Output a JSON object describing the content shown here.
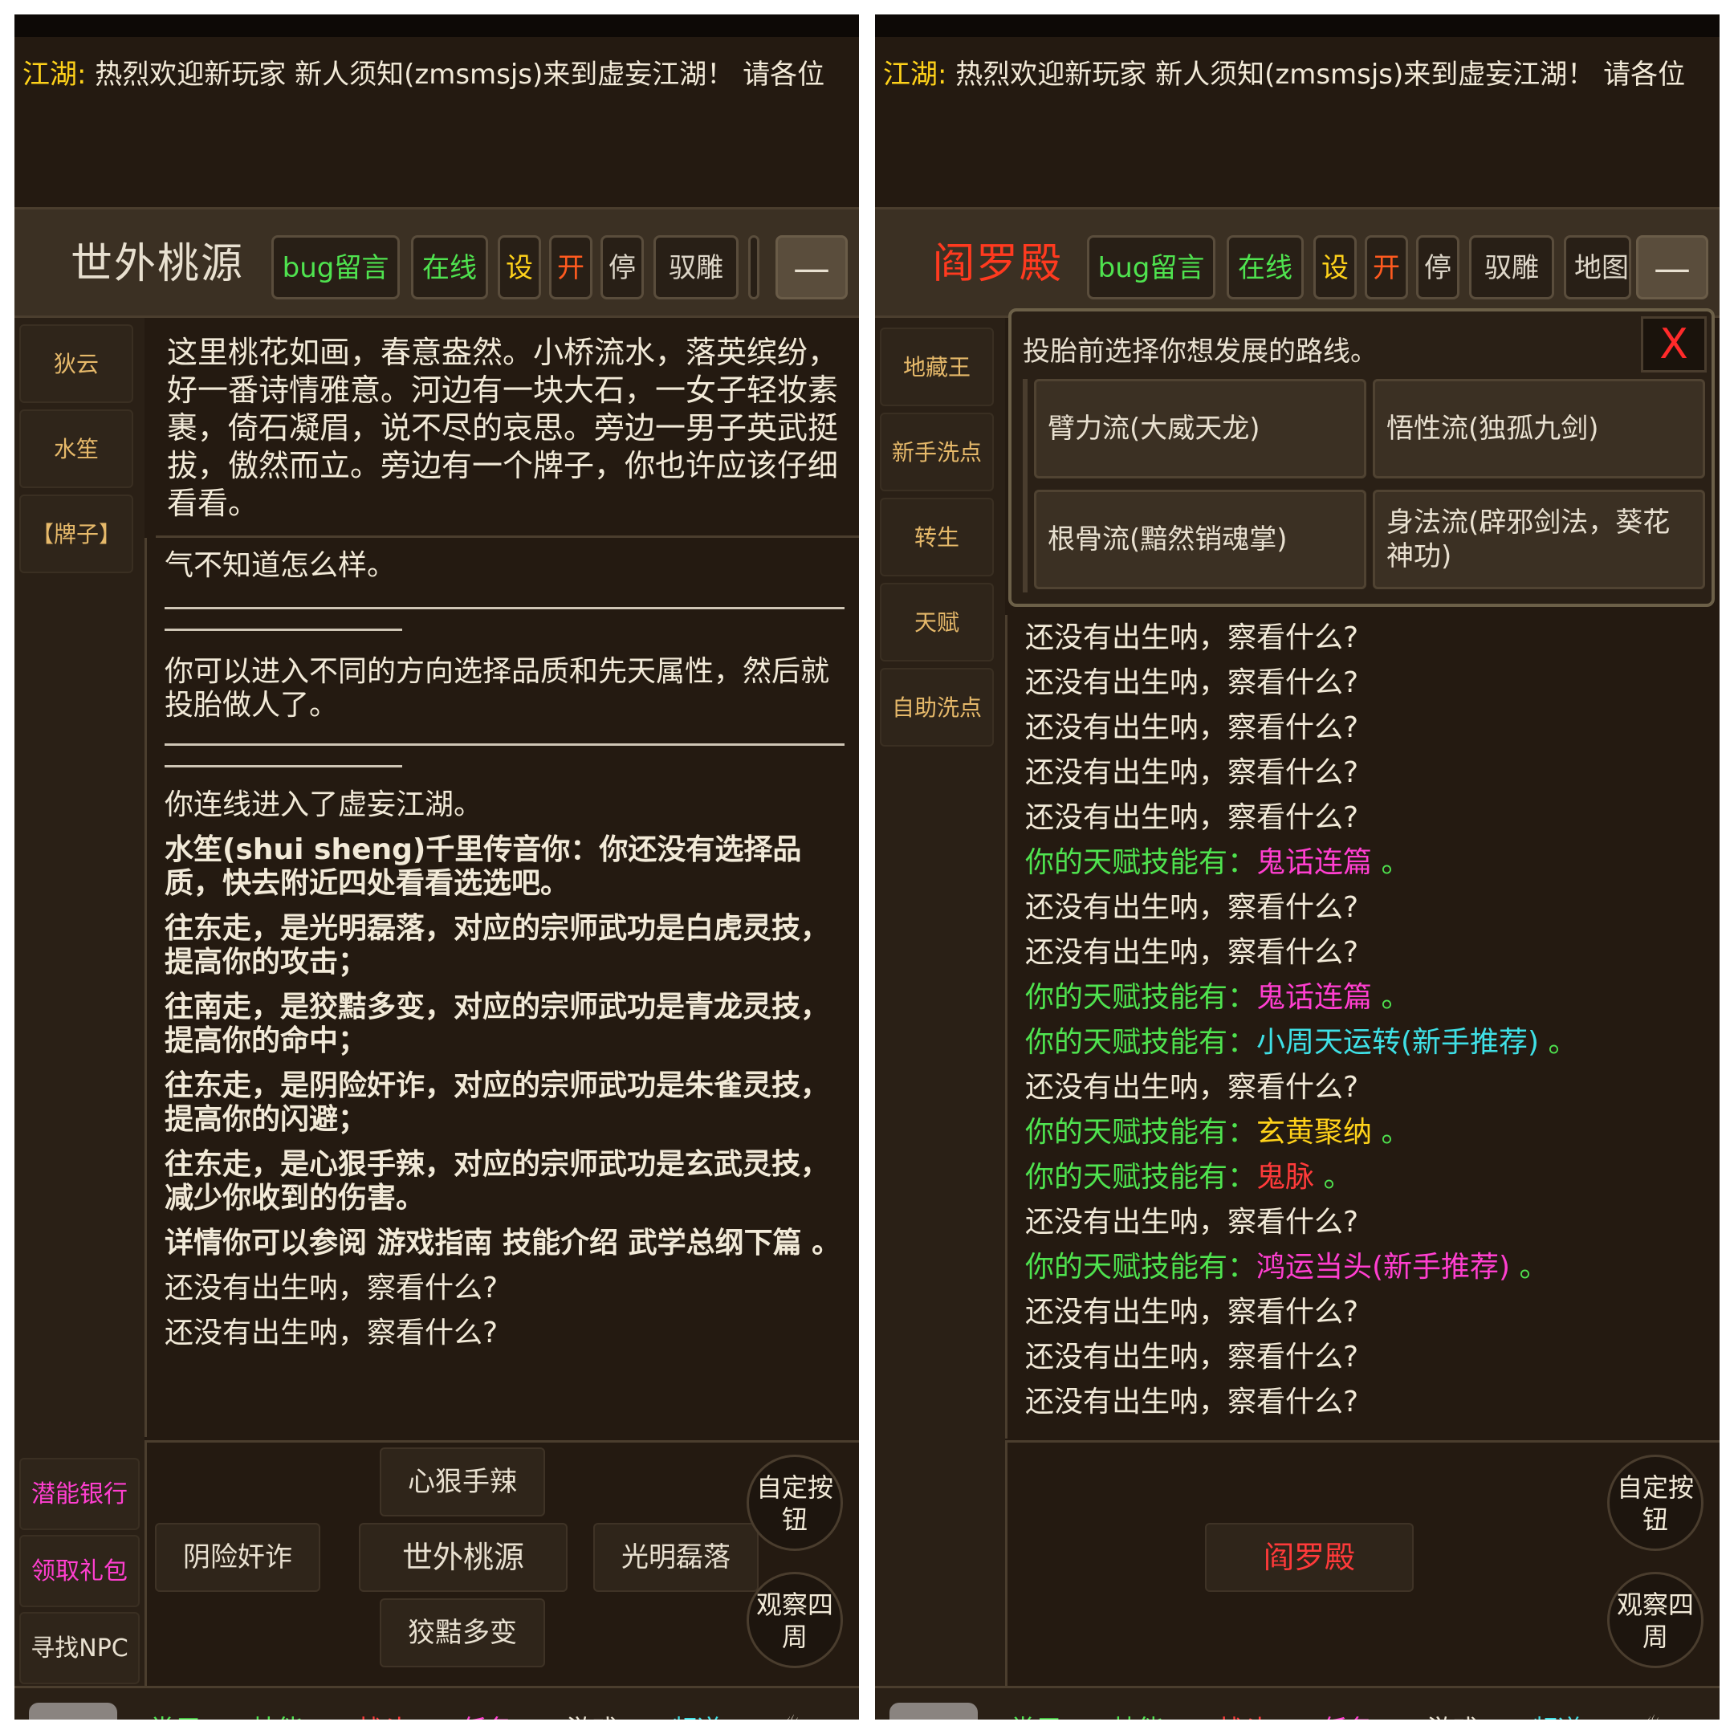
{
  "marquee": {
    "tag": "江湖:",
    "text": " 热烈欢迎新玩家  新人须知(zmsmsjs)来到虚妄江湖！ 请各位"
  },
  "toolbar": {
    "bug": "bug留言",
    "online": "在线",
    "settings": "设",
    "open": "开",
    "stop": "停",
    "tame": "驭雕",
    "map": "地图",
    "minus": "—"
  },
  "left": {
    "room_title": "世外桃源",
    "sidebar": [
      "狄云",
      "水笙",
      "【牌子】"
    ],
    "description": "这里桃花如画，春意盎然。小桥流水，落英缤纷，好一番诗情雅意。河边有一块大石，一女子轻妆素裹，倚石凝眉，说不尽的哀思。旁边一男子英武挺拔，傲然而立。旁边有一个牌子，你也许应该仔细看看。",
    "log": {
      "l1": "气不知道怎么样。",
      "l2": "你可以进入不同的方向选择品质和先天属性，然后就投胎做人了。",
      "l3": "你连线进入了虚妄江湖。",
      "l4": "水笙(shui sheng)千里传音你：你还没有选择品质，快去附近四处看看选选吧。",
      "l5": "往东走，是光明磊落，对应的宗师武功是白虎灵技，提高你的攻击；",
      "l6": "往南走，是狡黠多变，对应的宗师武功是青龙灵技，提高你的命中；",
      "l7": "往东走，是阴险奸诈，对应的宗师武功是朱雀灵技，提高你的闪避；",
      "l8": "往东走，是心狠手辣，对应的宗师武功是玄武灵技，减少你收到的伤害。",
      "l9": "详情你可以参阅 游戏指南 技能介绍 武学总纲下篇 。",
      "l10": "还没有出生呐，察看什么?",
      "l11": "还没有出生呐，察看什么?"
    },
    "side_lower": [
      "潜能银行",
      "领取礼包",
      "寻找NPC"
    ],
    "dirs": {
      "north": "心狠手辣",
      "west": "阴险奸诈",
      "center": "世外桃源",
      "east": "光明磊落",
      "south": "狡黠多变"
    }
  },
  "right": {
    "room_title": "阎罗殿",
    "sidebar": [
      "地藏王",
      "新手洗点",
      "转生",
      "天赋",
      "自助洗点"
    ],
    "dialog": {
      "title": "投胎前选择你想发展的路线。",
      "close": "X",
      "options": [
        "臂力流(大威天龙)",
        "悟性流(独孤九剑)",
        "根骨流(黯然销魂掌)",
        "身法流(辟邪剑法，葵花神功)"
      ]
    },
    "log": {
      "look": "还没有出生呐，察看什么?",
      "talent_prefix": "你的天赋技能有：",
      "end": " 。",
      "t1": "鬼话连篇",
      "t2": "鬼话连篇",
      "t3": "小周天运转(新手推荐)",
      "t4": "玄黄聚纳",
      "t5": "鬼脉",
      "t6": "鸿运当头(新手推荐)"
    },
    "center_btn": "阎罗殿"
  },
  "round": {
    "custom": "自定按钮",
    "look_around": "观察四周"
  },
  "tabs": [
    "常用",
    "技能",
    "战斗",
    "任务",
    "游戏",
    "频道"
  ],
  "colors": {
    "bg": "#241a11",
    "green": "#4fe34f",
    "magenta": "#ff3fd0",
    "cyan": "#3fe0e6",
    "yellow": "#ffd21a",
    "red": "#ff3a3a"
  }
}
